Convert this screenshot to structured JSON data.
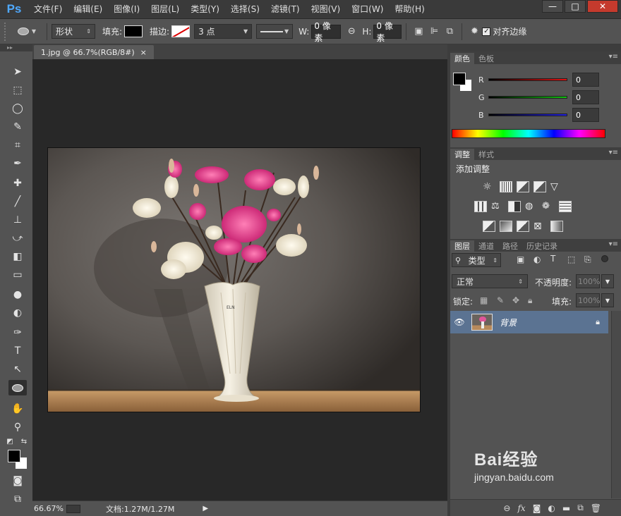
{
  "app": {
    "logo": "Ps"
  },
  "menu": [
    "文件(F)",
    "编辑(E)",
    "图像(I)",
    "图层(L)",
    "类型(Y)",
    "选择(S)",
    "滤镜(T)",
    "视图(V)",
    "窗口(W)",
    "帮助(H)"
  ],
  "window_controls": {
    "minimize": "—",
    "restore": "□",
    "close": "✕"
  },
  "options": {
    "mode": "形状",
    "fill_label": "填充:",
    "stroke_label": "描边:",
    "stroke_width": "3 点",
    "w_label": "W:",
    "w_value": "0 像素",
    "h_label": "H:",
    "h_value": "0 像素",
    "align_edges_label": "对齐边缘",
    "align_edges_checked": true
  },
  "document": {
    "tab_title": "1.jpg @ 66.7%(RGB/8#)",
    "tab_close": "×",
    "vase_label": "ELN"
  },
  "statusbar": {
    "zoom": "66.67%",
    "doc_info": "文档:1.27M/1.27M"
  },
  "color_panel": {
    "tabs": [
      "颜色",
      "色板"
    ],
    "channels": [
      {
        "label": "R",
        "value": "0",
        "color": "#d81e1e"
      },
      {
        "label": "G",
        "value": "0",
        "color": "#1fb81f"
      },
      {
        "label": "B",
        "value": "0",
        "color": "#2a2ad8"
      }
    ]
  },
  "adjust_panel": {
    "tabs": [
      "调整",
      "样式"
    ],
    "title": "添加调整"
  },
  "layers_panel": {
    "tabs": [
      "图层",
      "通道",
      "路径",
      "历史记录"
    ],
    "filter_kind": "类型",
    "blend_mode": "正常",
    "opacity_label": "不透明度:",
    "opacity_value": "100%",
    "lock_label": "锁定:",
    "fill_label": "填充:",
    "fill_value": "100%",
    "layers": [
      {
        "name": "背景",
        "visible": true,
        "locked": true
      }
    ],
    "footer_icons": [
      "link-icon",
      "fx-icon",
      "mask-icon",
      "adjustment-icon",
      "folder-icon",
      "new-layer-icon",
      "trash-icon"
    ]
  },
  "watermark": {
    "brand": "Bai经验",
    "url": "jingyan.baidu.com"
  },
  "colors": {
    "accent": "#4fa9ff",
    "selected_layer": "#5b7392",
    "close_button": "#c53a2d"
  }
}
